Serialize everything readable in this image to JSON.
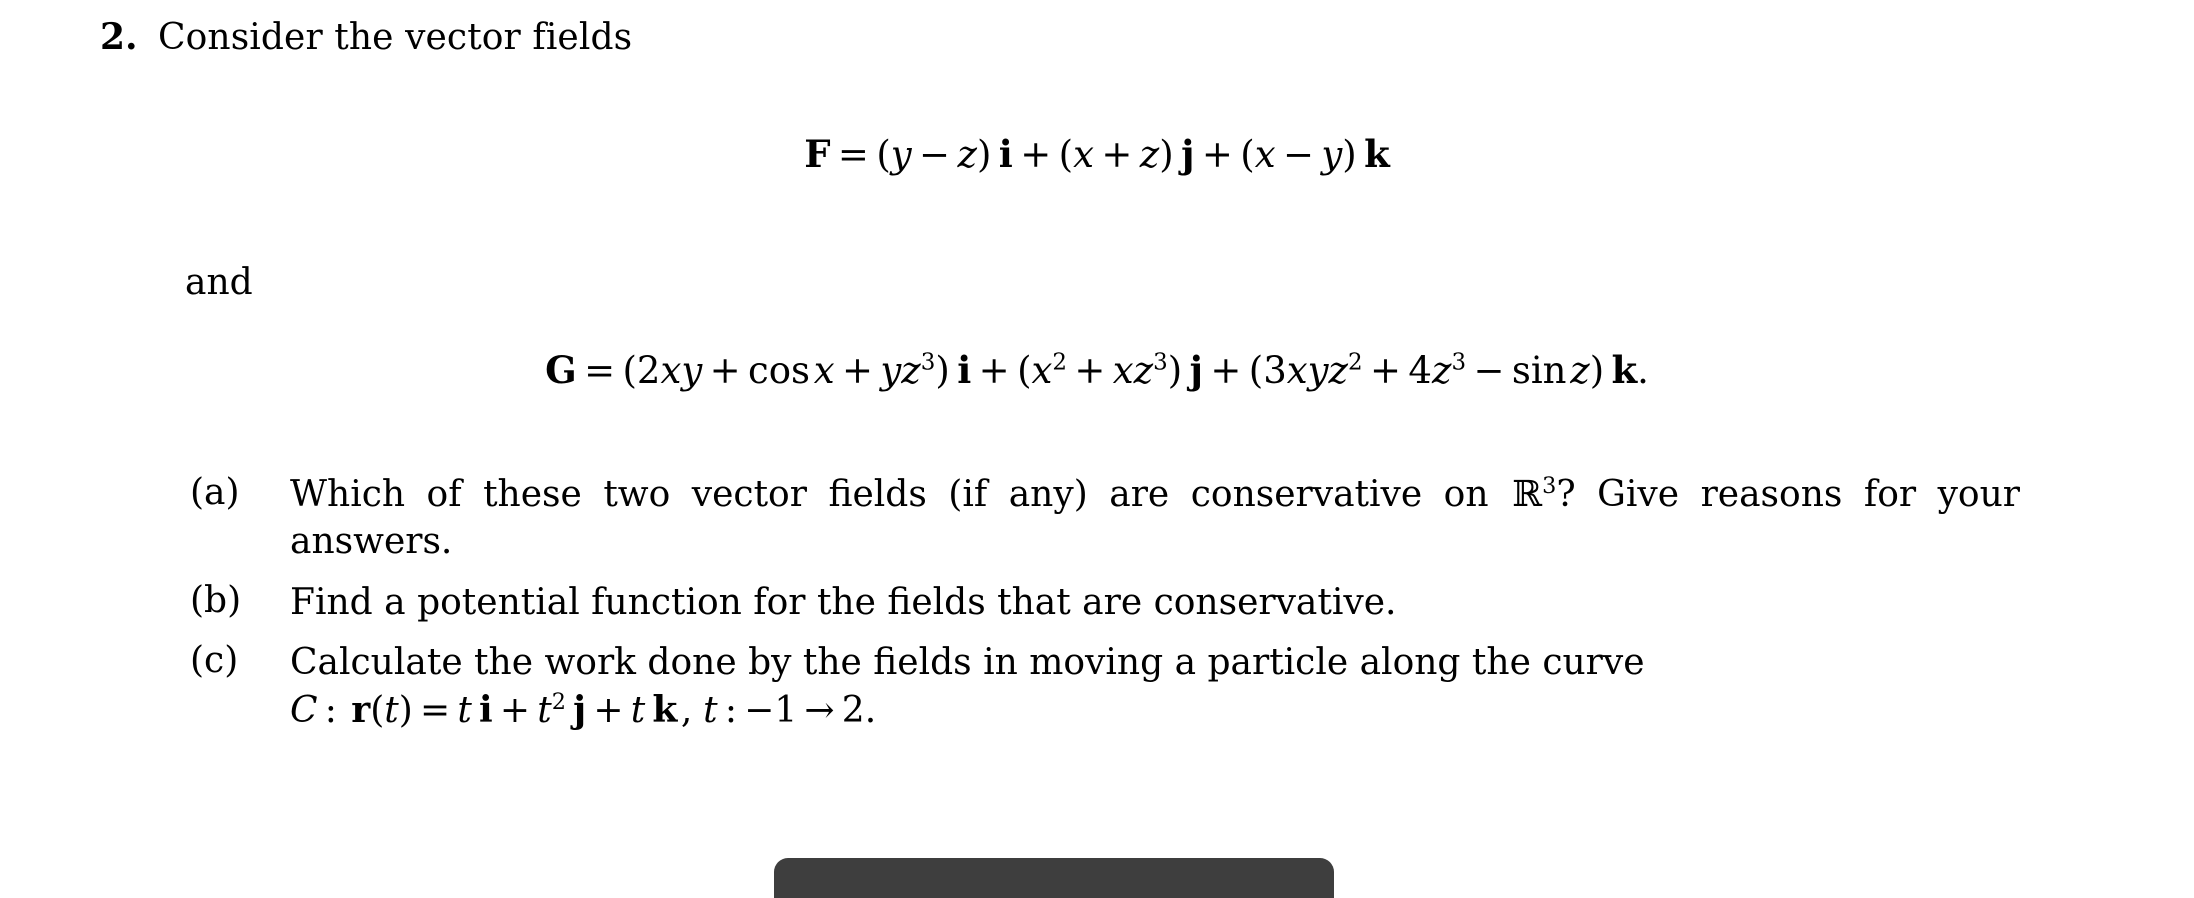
{
  "document": {
    "problem_number": "2.",
    "prompt": "Consider the vector fields",
    "conjunction": "and"
  },
  "equations": {
    "F": {
      "lhs": "F",
      "equals": "=",
      "terms": [
        {
          "open": "(",
          "body": "y − z",
          "close": ")",
          "unit": "i"
        },
        {
          "open": "(",
          "body": "x + z",
          "close": ")",
          "unit": "j"
        },
        {
          "open": "(",
          "body": "x − y",
          "close": ")",
          "unit": "k"
        }
      ],
      "plain": "F = (y − z) i + (x + z) j + (x − y) k"
    },
    "G": {
      "lhs": "G",
      "equals": "=",
      "terms": [
        {
          "open": "(",
          "body": "2xy + cos x + yz³",
          "close": ")",
          "unit": "i"
        },
        {
          "open": "(",
          "body": "x² + xz³",
          "close": ")",
          "unit": "j"
        },
        {
          "open": "(",
          "body": "3xyz² + 4z³ − sin z",
          "close": ")",
          "unit": "k"
        }
      ],
      "trailing_period": ".",
      "plain": "G = (2xy + cos x + yz³) i + (x² + xz³) j + (3xyz² + 4z³ − sin z) k."
    }
  },
  "parts": [
    {
      "label": "(a)",
      "text_before_symbol": "Which of these two vector fields (if any) are conservative on ",
      "symbol": "R",
      "symbol_power": "3",
      "text_after_symbol": "? Give reasons for your answers.",
      "plain": "Which of these two vector fields (if any) are conservative on R³? Give reasons for your answers."
    },
    {
      "label": "(b)",
      "plain": "Find a potential function for the fields that are conservative."
    },
    {
      "label": "(c)",
      "plain": "Calculate the work done by the fields in moving a particle along the curve",
      "line1": "Calculate the work done by the fields in moving a particle along the curve",
      "curve": {
        "name": "C",
        "colon": ":",
        "function": "r(t)",
        "equals": "=",
        "expression": "t i + t² j + t k",
        "parameter": "t",
        "range_start": "−1",
        "arrow": "→",
        "range_end": "2",
        "period": ".",
        "plain": "C : r(t) = t i + t² j + t k, t : −1 → 2."
      }
    }
  ],
  "toolbar_stub": {
    "color": "#3e3e3e"
  },
  "colors": {
    "page_background": "#ffffff",
    "text": "#000000",
    "toolbar": "#3e3e3e"
  }
}
